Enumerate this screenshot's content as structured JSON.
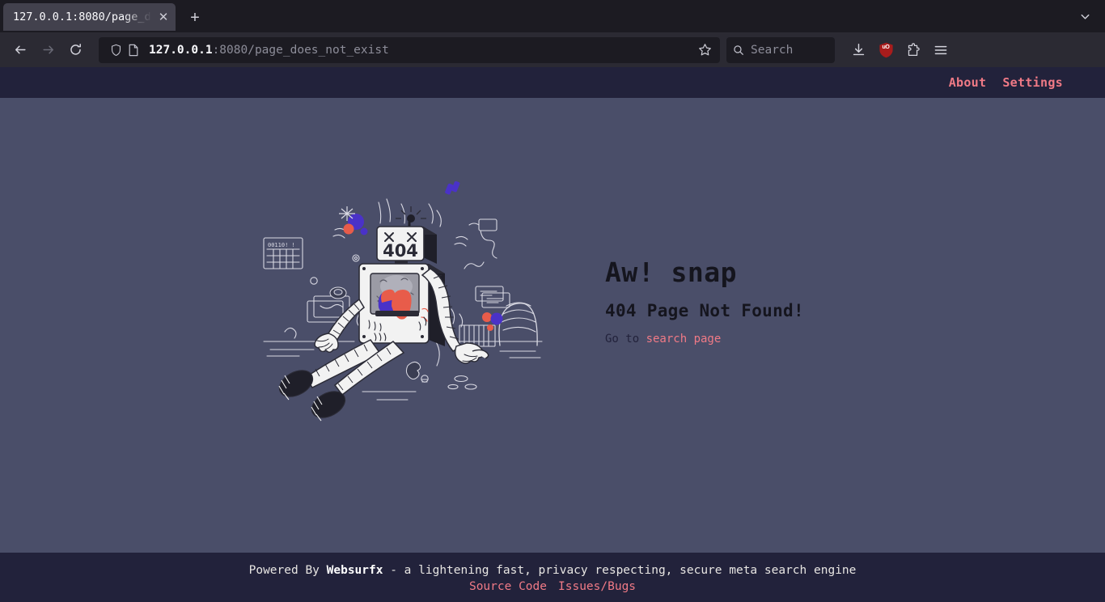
{
  "browser": {
    "tab": {
      "title": "127.0.0.1:8080/page_d",
      "close_label": "✕"
    },
    "new_tab_label": "+",
    "list_all_tabs_icon": "chevron-down-icon",
    "nav": {
      "back_icon": "back-arrow-icon",
      "forward_icon": "forward-arrow-icon",
      "reload_icon": "reload-icon"
    },
    "urlbar": {
      "shield_icon": "tracking-protection-shield-icon",
      "page_icon": "page-document-icon",
      "host": "127.0.0.1",
      "path": ":8080/page_does_not_exist",
      "bookmark_icon": "bookmark-star-icon"
    },
    "search": {
      "icon": "search-icon",
      "placeholder": "Search"
    },
    "toolbar": {
      "downloads_icon": "download-arrow-icon",
      "ublock_label": "uO",
      "ublock_icon": "ublock-origin-shield-icon",
      "extensions_icon": "extensions-puzzle-icon",
      "menu_icon": "hamburger-menu-icon"
    }
  },
  "page": {
    "header": {
      "about_label": "About",
      "settings_label": "Settings"
    },
    "error": {
      "headline": "Aw! snap",
      "subhead": "404 Page Not Found!",
      "go_to_prefix": "Go to ",
      "search_page_link": "search page",
      "illustration_name": "broken-robot-404-illustration",
      "robot_screen_text": "404"
    },
    "footer": {
      "powered_by_prefix": "Powered By ",
      "brand": "Websurfx",
      "tagline": " - a lightening fast, privacy respecting, secure meta search engine",
      "source_code_label": "Source Code",
      "issues_label": "Issues/Bugs"
    }
  },
  "colors": {
    "chrome_tabstrip": "#1c1b22",
    "chrome_navbar": "#2b2a33",
    "page_header_footer": "#22223b",
    "page_body": "#4a4e69",
    "accent_pink": "#f07a86",
    "heading_dark": "#15151e",
    "ublock_red": "#a81c1c"
  }
}
